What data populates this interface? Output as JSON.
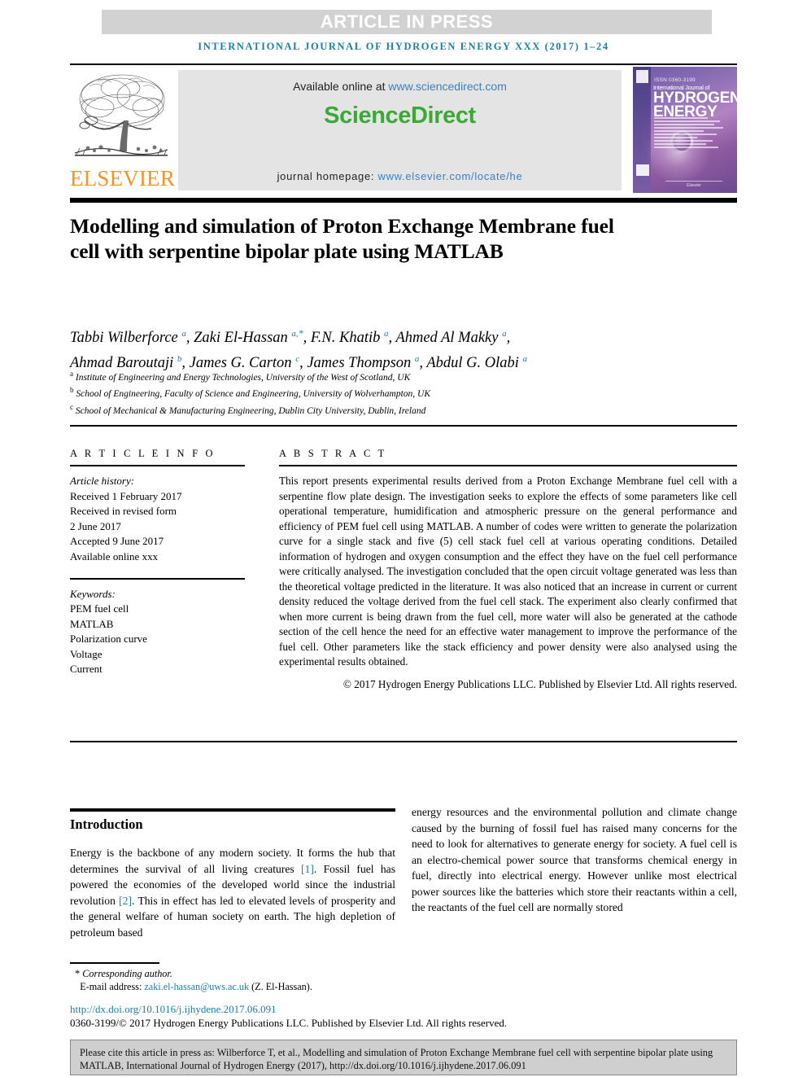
{
  "banner": {
    "article_in_press": "ARTICLE IN PRESS"
  },
  "running_head": "INTERNATIONAL JOURNAL OF HYDROGEN ENERGY XXX (2017) 1–24",
  "masthead": {
    "publisher": "ELSEVIER",
    "available_label": "Available online at ",
    "available_url": "www.sciencedirect.com",
    "sciencedirect_logo": "ScienceDirect",
    "homepage_label": "journal homepage: ",
    "homepage_url": "www.elsevier.com/locate/he",
    "cover": {
      "kicker": "ISSN 0360-3199",
      "line1": "International Journal of",
      "line2": "HYDROGEN",
      "line3": "ENERGY",
      "footer": "Elsevier"
    },
    "colors": {
      "link_blue": "#3b7fc4",
      "sciencedirect_green": "#3aa935",
      "elsevier_orange": "#f79226",
      "running_head_blue": "#1a7fa8",
      "band_gray": "#d2d2d2",
      "panel_gray": "#e4e4e4"
    }
  },
  "article": {
    "title": "Modelling and simulation of Proton Exchange Membrane fuel cell with serpentine bipolar plate using MATLAB",
    "authors_line1_parts": [
      {
        "name": "Tabbi Wilberforce ",
        "mark": "a",
        "star": false,
        "sep": ", "
      },
      {
        "name": "Zaki El-Hassan ",
        "mark": "a,",
        "star": true,
        "sep": ", "
      },
      {
        "name": "F.N. Khatib ",
        "mark": "a",
        "star": false,
        "sep": ", "
      },
      {
        "name": "Ahmed Al Makky ",
        "mark": "a",
        "star": false,
        "sep": ","
      }
    ],
    "authors_line2_parts": [
      {
        "name": "Ahmad Baroutaji ",
        "mark": "b",
        "star": false,
        "sep": ", "
      },
      {
        "name": "James G. Carton ",
        "mark": "c",
        "star": false,
        "sep": ", "
      },
      {
        "name": "James Thompson ",
        "mark": "a",
        "star": false,
        "sep": ", "
      },
      {
        "name": "Abdul G. Olabi ",
        "mark": "a",
        "star": false,
        "sep": ""
      }
    ],
    "affiliations": [
      {
        "mark": "a",
        "text": "Institute of Engineering and Energy Technologies, University of the West of Scotland, UK"
      },
      {
        "mark": "b",
        "text": "School of Engineering, Faculty of Science and Engineering, University of Wolverhampton, UK"
      },
      {
        "mark": "c",
        "text": "School of Mechanical & Manufacturing Engineering, Dublin City University, Dublin, Ireland"
      }
    ]
  },
  "article_info": {
    "heading": "A R T I C L E   I N F O",
    "history_label": "Article history:",
    "history": [
      "Received 1 February 2017",
      "Received in revised form",
      "2 June 2017",
      "Accepted 9 June 2017",
      "Available online xxx"
    ],
    "keywords_label": "Keywords:",
    "keywords": [
      "PEM fuel cell",
      "MATLAB",
      "Polarization curve",
      "Voltage",
      "Current"
    ]
  },
  "abstract": {
    "heading": "A B S T R A C T",
    "text": "This report presents experimental results derived from a Proton Exchange Membrane fuel cell with a serpentine flow plate design. The investigation seeks to explore the effects of some parameters like cell operational temperature, humidification and atmospheric pressure on the general performance and efficiency of PEM fuel cell using MATLAB. A number of codes were written to generate the polarization curve for a single stack and five (5) cell stack fuel cell at various operating conditions. Detailed information of hydrogen and oxygen consumption and the effect they have on the fuel cell performance were critically analysed. The investigation concluded that the open circuit voltage generated was less than the theoretical voltage predicted in the literature. It was also noticed that an increase in current or current density reduced the voltage derived from the fuel cell stack. The experiment also clearly confirmed that when more current is being drawn from the fuel cell, more water will also be generated at the cathode section of the cell hence the need for an effective water management to improve the performance of the fuel cell. Other parameters like the stack efficiency and power density were also analysed using the experimental results obtained.",
    "copyright": "© 2017 Hydrogen Energy Publications LLC. Published by Elsevier Ltd. All rights reserved."
  },
  "body": {
    "intro_heading": "Introduction",
    "left_col": {
      "seg1": "Energy is the backbone of any modern society. It forms the hub that determines the survival of all living creatures ",
      "ref1": "[1]",
      "seg2": ". Fossil fuel has powered the economies of the developed world since the industrial revolution ",
      "ref2": "[2]",
      "seg3": ". This in effect has led to elevated levels of prosperity and the general welfare of human society on earth. The high depletion of petroleum based"
    },
    "right_col": {
      "text": "energy resources and the environmental pollution and climate change caused by the burning of fossil fuel has raised many concerns for the need to look for alternatives to generate energy for society. A fuel cell is an electro-chemical power source that transforms chemical energy in fuel, directly into electrical energy. However unlike most electrical power sources like the batteries which store their reactants within a cell, the reactants of the fuel cell are normally stored"
    }
  },
  "footer": {
    "corresponding_marker": "*",
    "corresponding_label": "Corresponding author.",
    "email_label": "E-mail address: ",
    "email": "zaki.el-hassan@uws.ac.uk",
    "email_suffix": " (Z. El-Hassan).",
    "doi": "http://dx.doi.org/10.1016/j.ijhydene.2017.06.091",
    "issn_line": "0360-3199/© 2017 Hydrogen Energy Publications LLC. Published by Elsevier Ltd. All rights reserved."
  },
  "cite_box": {
    "text": "Please cite this article in press as: Wilberforce T, et al., Modelling and simulation of Proton Exchange Membrane fuel cell with serpentine bipolar plate using MATLAB, International Journal of Hydrogen Energy (2017), http://dx.doi.org/10.1016/j.ijhydene.2017.06.091"
  }
}
